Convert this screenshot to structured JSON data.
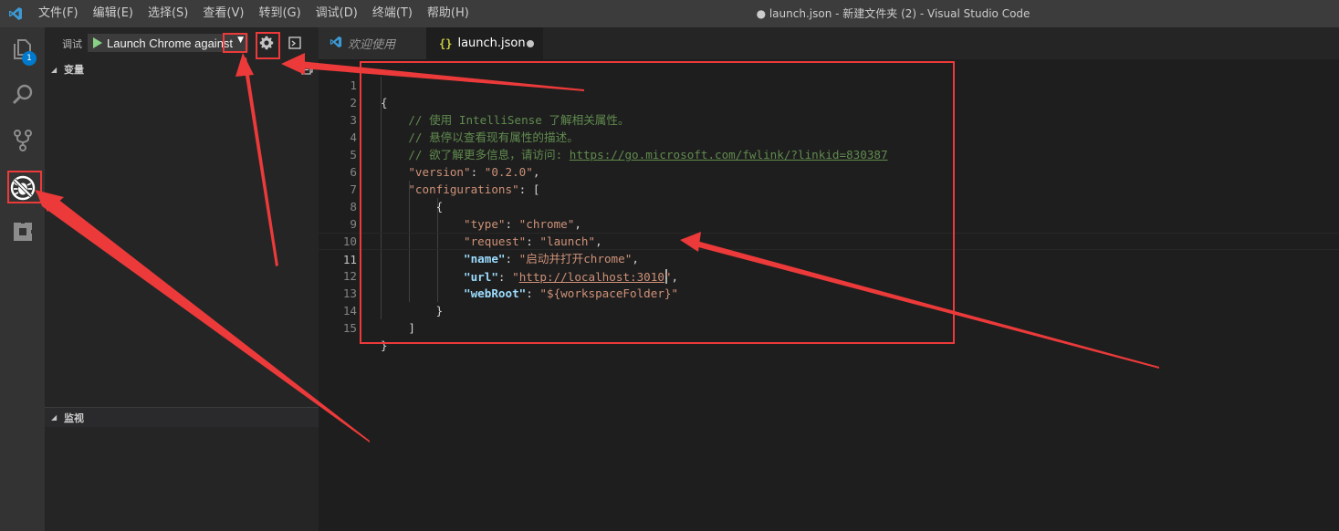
{
  "titlebar": {
    "menu": [
      "文件(F)",
      "编辑(E)",
      "选择(S)",
      "查看(V)",
      "转到(G)",
      "调试(D)",
      "终端(T)",
      "帮助(H)"
    ],
    "window_title": "● launch.json - 新建文件夹 (2) - Visual Studio Code"
  },
  "activitybar": {
    "items": [
      "explorer-icon",
      "search-icon",
      "source-control-icon",
      "debug-icon",
      "extensions-icon"
    ],
    "explorer_badge": "1"
  },
  "sidebar": {
    "debug_title": "调试",
    "configuration": "Launch Chrome against",
    "variables_header": "变量",
    "watch_header": "监视"
  },
  "tabs": {
    "welcome": "欢迎使用",
    "launch_icon": "{}",
    "launch": "launch.json"
  },
  "editor": {
    "line_numbers": [
      "1",
      "2",
      "3",
      "4",
      "5",
      "6",
      "7",
      "8",
      "9",
      "10",
      "11",
      "12",
      "13",
      "14",
      "15"
    ],
    "comment1": "// 使用 IntelliSense 了解相关属性。",
    "comment2": "// 悬停以查看现有属性的描述。",
    "comment3_prefix": "// 欲了解更多信息，请访问: ",
    "comment3_link": "https://go.microsoft.com/fwlink/?linkid=830387",
    "version_key": "\"version\"",
    "version_val": "\"0.2.0\"",
    "configs_key": "\"configurations\"",
    "type_key": "\"type\"",
    "type_val": "\"chrome\"",
    "request_key": "\"request\"",
    "request_val": "\"launch\"",
    "name_key": "\"name\"",
    "name_val": "\"启动并打开chrome\"",
    "url_key": "\"url\"",
    "url_quote_open": "\"",
    "url_val": "http://localhost:3010",
    "url_quote_close": "\"",
    "webroot_key": "\"webRoot\"",
    "webroot_val": "\"${workspaceFolder}\""
  },
  "colors": {
    "annotation": "#ec3a3a",
    "accent": "#007acc",
    "comment": "#608b4e",
    "key": "#9cdcfe",
    "string": "#ce9178"
  }
}
